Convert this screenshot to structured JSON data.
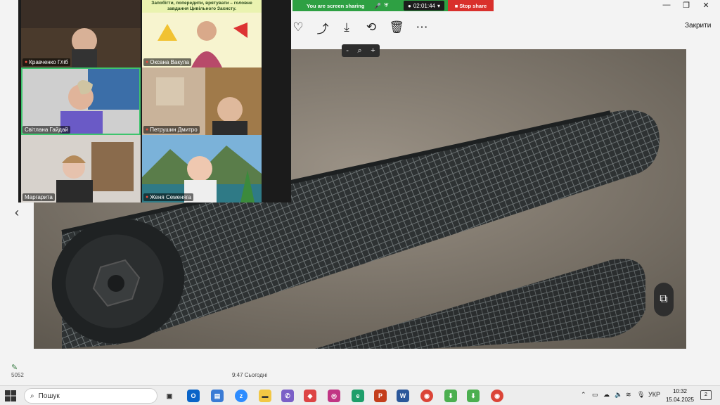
{
  "share_bar": {
    "status": "You are screen sharing",
    "timer": "02:01:44",
    "stop_label": "Stop share"
  },
  "toolbar": {
    "close_label": "Закрити",
    "zoom_minus": "-",
    "zoom_plus": "+"
  },
  "window_controls": {
    "minimize": "—",
    "maximize": "❐",
    "close": "✕"
  },
  "gallery": {
    "slide_text": "Запобігти, попередити, врятувати – головне завдання Цивільного Захисту.",
    "participants": [
      {
        "name": "Кравченко Гліб",
        "muted": true
      },
      {
        "name": "Оксана Вакула",
        "muted": true
      },
      {
        "name": "Світлана Гайдай",
        "muted": false
      },
      {
        "name": "Петрушин Дмитро",
        "muted": true
      },
      {
        "name": "Маргарита",
        "muted": false
      },
      {
        "name": "Женя Семеняга",
        "muted": true
      }
    ]
  },
  "footer": {
    "timestamp": "9:47 Сьогодні",
    "counter": "5052"
  },
  "taskbar": {
    "search_placeholder": "Пошук",
    "language": "УКР",
    "time": "10:32",
    "date": "15.04.2025",
    "notifications": "2"
  },
  "colors": {
    "share_green": "#2ea043",
    "stop_red": "#d9302c",
    "active_speaker": "#3ec46d"
  }
}
